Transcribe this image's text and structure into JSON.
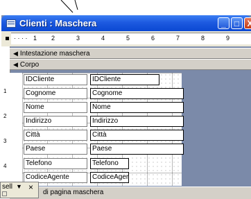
{
  "window": {
    "title": "Clienti : Maschera",
    "minimize": "_",
    "maximize": "□",
    "close": "X"
  },
  "ruler": {
    "ticks": [
      "1",
      "2",
      "3",
      "4",
      "5",
      "6",
      "7",
      "8",
      "9"
    ],
    "vticks": [
      "1",
      "2",
      "3",
      "4"
    ]
  },
  "sections": {
    "header": "Intestazione maschera",
    "body": "Corpo",
    "footer": "di pagina maschera"
  },
  "fields": [
    {
      "label": "IDCliente",
      "value": "IDCliente"
    },
    {
      "label": "Cognome",
      "value": "Cognome"
    },
    {
      "label": "Nome",
      "value": "Nome"
    },
    {
      "label": "Indirizzo",
      "value": "Indirizzo"
    },
    {
      "label": "Città",
      "value": "Città"
    },
    {
      "label": "Paese",
      "value": "Paese"
    },
    {
      "label": "Telefono",
      "value": "Telefono"
    },
    {
      "label": "CodiceAgente",
      "value": "CodiceAger"
    }
  ],
  "panel": {
    "label": "sell",
    "dropdown": "▼",
    "close": "×"
  }
}
